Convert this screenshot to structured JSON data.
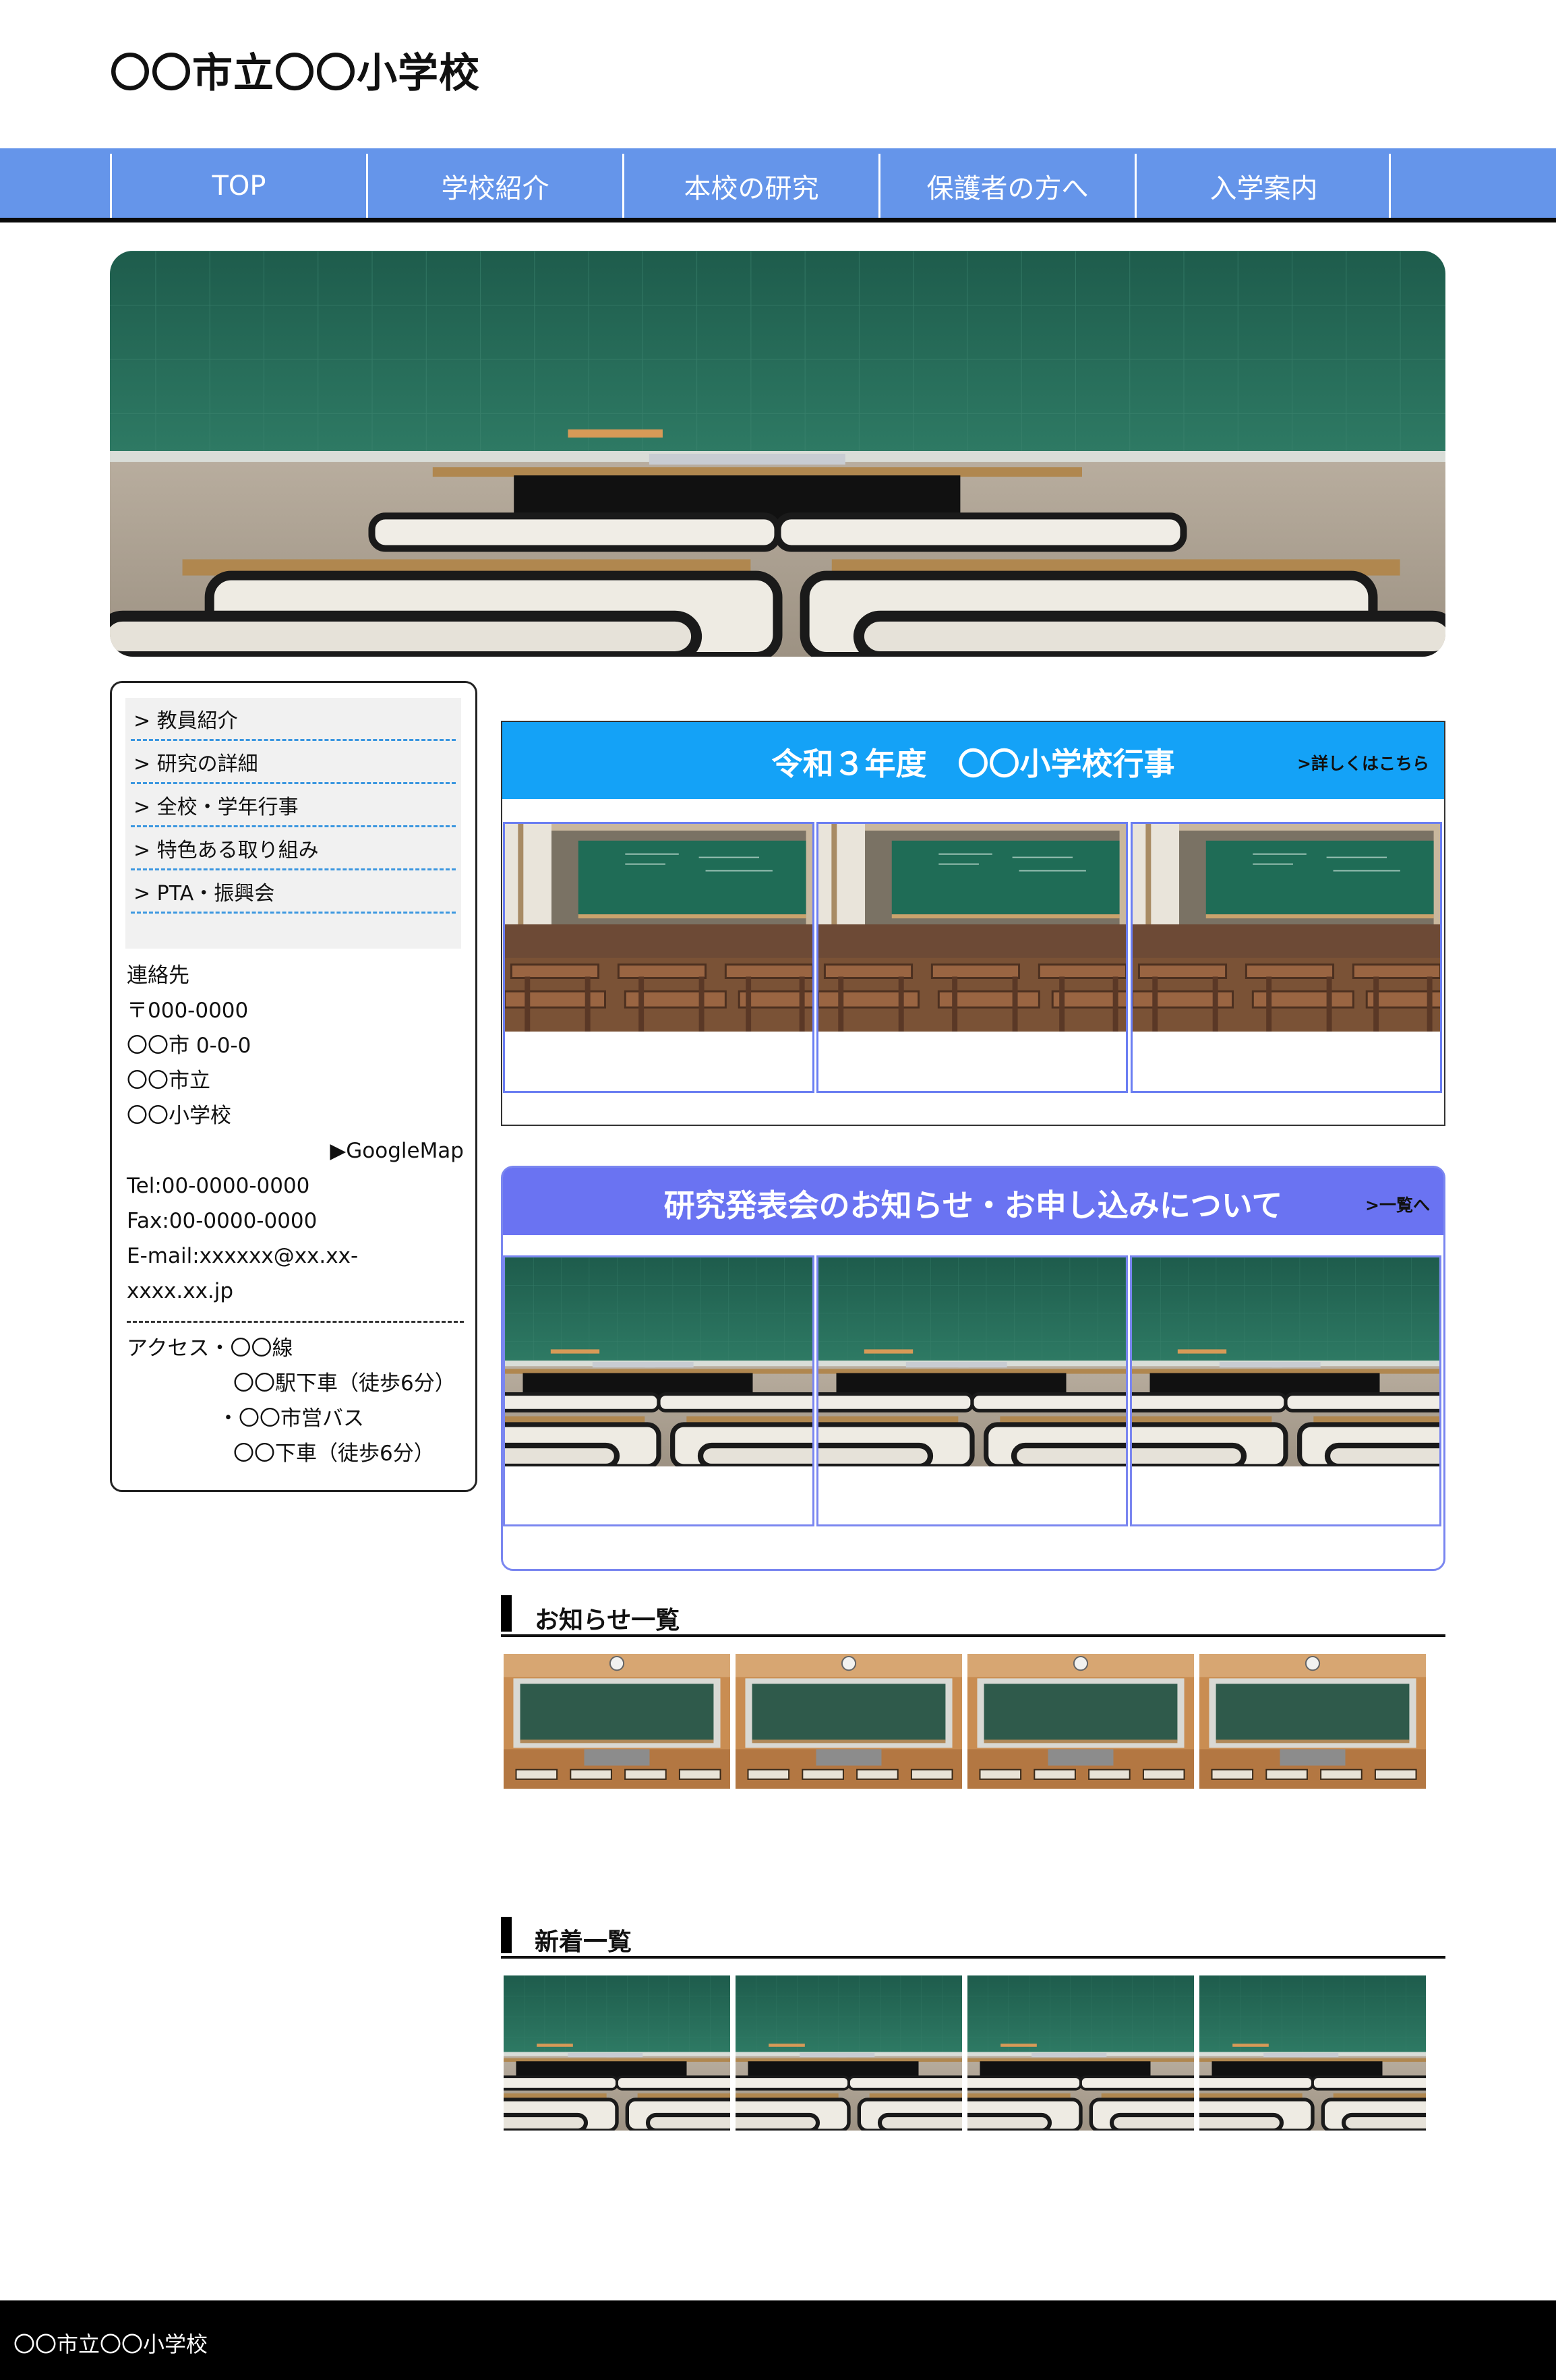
{
  "site": {
    "title": "〇〇市立〇〇小学校"
  },
  "nav": {
    "items": [
      "TOP",
      "学校紹介",
      "本校の研究",
      "保護者の方へ",
      "入学案内"
    ],
    "color": "#6595ea"
  },
  "sidebar": {
    "menu": [
      "> 教員紹介",
      "> 研究の詳細",
      "> 全校・学年行事",
      "> 特色ある取り組み",
      "> PTA・振興会"
    ],
    "contact": {
      "heading": "連絡先",
      "postal": "〒000-0000",
      "address1": "〇〇市 0-0-0",
      "address2": "〇〇市立",
      "address3": "〇〇小学校",
      "map_link": "▶GoogleMap",
      "tel": "Tel:00-0000-0000",
      "fax": "Fax:00-0000-0000",
      "email1": "E-mail:xxxxxx@xx.xx-",
      "email2": "xxxx.xx.jp",
      "access1": "アクセス・〇〇線",
      "access2": "〇〇駅下車（徒歩6分）",
      "access3": "・〇〇市営バス",
      "access4": "〇〇下車（徒歩6分）"
    }
  },
  "events": {
    "title": "令和３年度　〇〇小学校行事",
    "more": ">詳しくはこちら",
    "color": "#14a2f7"
  },
  "research": {
    "title": "研究発表会のお知らせ・お申し込みについて",
    "more": ">一覧へ",
    "color": "#6a73f2"
  },
  "news": {
    "title": "お知らせ一覧"
  },
  "latest": {
    "title": "新着一覧"
  },
  "footer": {
    "text": "〇〇市立〇〇小学校"
  }
}
